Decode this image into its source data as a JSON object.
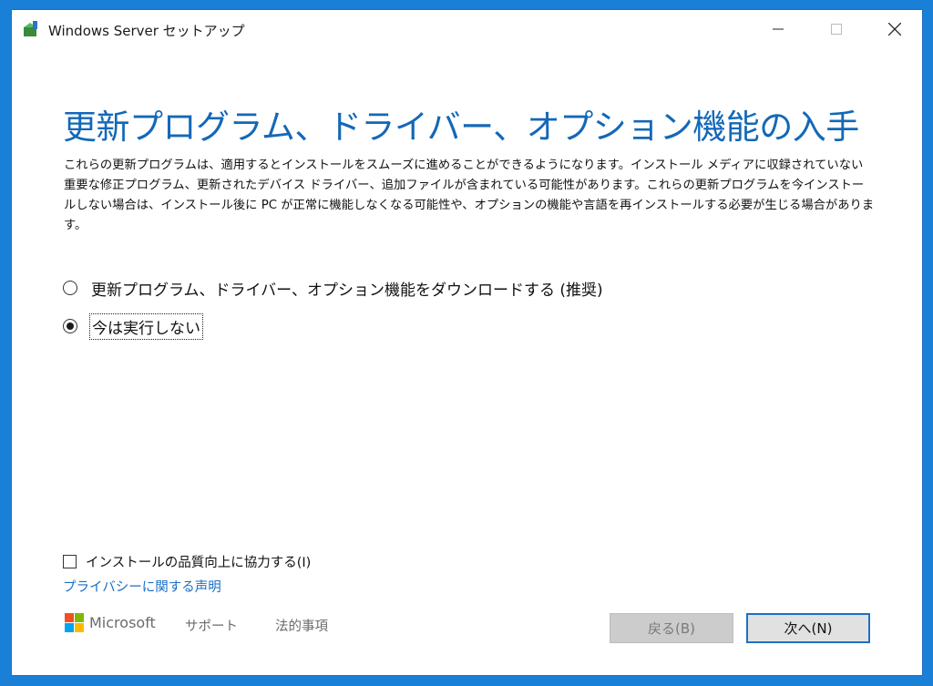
{
  "window": {
    "title": "Windows Server セットアップ"
  },
  "page": {
    "heading": "更新プログラム、ドライバー、オプション機能の入手",
    "description": "これらの更新プログラムは、適用するとインストールをスムーズに進めることができるようになります。インストール メディアに収録されていない重要な修正プログラム、更新されたデバイス ドライバー、追加ファイルが含まれている可能性があります。これらの更新プログラムを今インストールしない場合は、インストール後に PC が正常に機能しなくなる可能性や、オプションの機能や言語を再インストールする必要が生じる場合があります。"
  },
  "options": {
    "download_label": "更新プログラム、ドライバー、オプション機能をダウンロードする (推奨)",
    "skip_label": "今は実行しない",
    "selected": "skip"
  },
  "improve": {
    "label": "インストールの品質向上に協力する(I)",
    "checked": false
  },
  "privacy_link": "プライバシーに関する声明",
  "footer": {
    "brand": "Microsoft",
    "support": "サポート",
    "legal": "法的事項"
  },
  "buttons": {
    "back": "戻る(B)",
    "next": "次へ(N)"
  },
  "colors": {
    "accent": "#1368b8",
    "link": "#1a6fc4",
    "desktop": "#1a7fd6"
  },
  "icons": {
    "app": "setup-box-icon",
    "minimize": "minimize-icon",
    "maximize": "maximize-icon",
    "close": "close-icon"
  }
}
